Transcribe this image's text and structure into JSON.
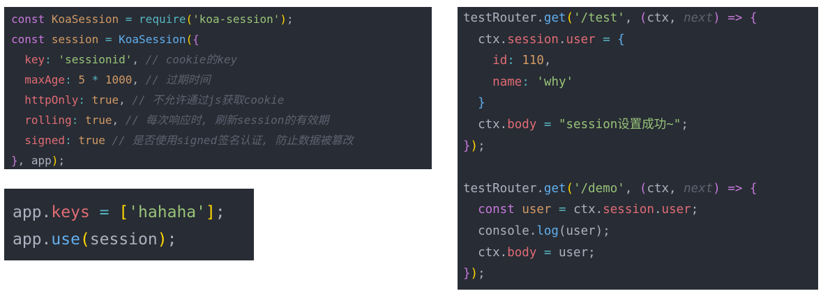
{
  "colors": {
    "background": "#282c34",
    "keyword": "#c678dd",
    "variable": "#d19a66",
    "function": "#56b6c2",
    "string": "#98c379",
    "bracket": "#ffd700",
    "method": "#61afef",
    "property": "#e06c75",
    "comment": "#5c6370",
    "plain": "#abb2bf"
  },
  "snippets": [
    {
      "name": "koa-session-config",
      "lines": [
        [
          [
            "const",
            "k"
          ],
          [
            " ",
            "p"
          ],
          [
            "KoaSession",
            "v"
          ],
          [
            " = ",
            "f"
          ],
          [
            "require",
            "f"
          ],
          [
            "(",
            "y"
          ],
          [
            "'koa-session'",
            "s"
          ],
          [
            ")",
            "y"
          ],
          [
            ";",
            "p"
          ]
        ],
        [
          [
            "const",
            "k"
          ],
          [
            " ",
            "p"
          ],
          [
            "session",
            "v"
          ],
          [
            " = ",
            "f"
          ],
          [
            "KoaSession",
            "b"
          ],
          [
            "(",
            "y"
          ],
          [
            "{",
            "m"
          ]
        ],
        [
          [
            "  ",
            "p"
          ],
          [
            "key",
            "r"
          ],
          [
            ": ",
            "f"
          ],
          [
            "'sessionid'",
            "s"
          ],
          [
            ", ",
            "p"
          ],
          [
            "// cookie的key",
            "c"
          ]
        ],
        [
          [
            "  ",
            "p"
          ],
          [
            "maxAge",
            "r"
          ],
          [
            ": ",
            "f"
          ],
          [
            "5",
            "v"
          ],
          [
            " * ",
            "f"
          ],
          [
            "1000",
            "v"
          ],
          [
            ", ",
            "p"
          ],
          [
            "// 过期时间",
            "c"
          ]
        ],
        [
          [
            "  ",
            "p"
          ],
          [
            "httpOnly",
            "r"
          ],
          [
            ": ",
            "f"
          ],
          [
            "true",
            "v"
          ],
          [
            ", ",
            "p"
          ],
          [
            "// 不允许通过js获取cookie",
            "c"
          ]
        ],
        [
          [
            "  ",
            "p"
          ],
          [
            "rolling",
            "r"
          ],
          [
            ": ",
            "f"
          ],
          [
            "true",
            "v"
          ],
          [
            ", ",
            "p"
          ],
          [
            "// 每次响应时, 刷新session的有效期",
            "c"
          ]
        ],
        [
          [
            "  ",
            "p"
          ],
          [
            "signed",
            "r"
          ],
          [
            ": ",
            "f"
          ],
          [
            "true",
            "v"
          ],
          [
            " ",
            "p"
          ],
          [
            "// 是否使用signed签名认证, 防止数据被篡改",
            "c"
          ]
        ],
        [
          [
            "}",
            "m"
          ],
          [
            ", app",
            "p"
          ],
          [
            ")",
            "y"
          ],
          [
            ";",
            "p"
          ]
        ]
      ]
    },
    {
      "name": "app-keys",
      "lines": [
        [
          [
            "app",
            "p"
          ],
          [
            ".",
            "p"
          ],
          [
            "keys",
            "r"
          ],
          [
            " = ",
            "f"
          ],
          [
            "[",
            "y"
          ],
          [
            "'hahaha'",
            "s"
          ],
          [
            "]",
            "y"
          ],
          [
            ";",
            "p"
          ]
        ],
        [
          [
            "app",
            "p"
          ],
          [
            ".",
            "p"
          ],
          [
            "use",
            "b"
          ],
          [
            "(",
            "y"
          ],
          [
            "session",
            "p"
          ],
          [
            ")",
            "y"
          ],
          [
            ";",
            "p"
          ]
        ]
      ]
    },
    {
      "name": "test-router",
      "lines": [
        [
          [
            "testRouter",
            "p"
          ],
          [
            ".",
            "p"
          ],
          [
            "get",
            "b"
          ],
          [
            "(",
            "y"
          ],
          [
            "'/test'",
            "s"
          ],
          [
            ", ",
            "p"
          ],
          [
            "(",
            "m"
          ],
          [
            "ctx, ",
            "p"
          ],
          [
            "next",
            "c"
          ],
          [
            ")",
            "m"
          ],
          [
            " => ",
            "k"
          ],
          [
            "{",
            "m"
          ]
        ],
        [
          [
            "  ctx.",
            "p"
          ],
          [
            "session",
            "r"
          ],
          [
            ".",
            "p"
          ],
          [
            "user",
            "r"
          ],
          [
            " = ",
            "f"
          ],
          [
            "{",
            "b"
          ]
        ],
        [
          [
            "    ",
            "p"
          ],
          [
            "id",
            "r"
          ],
          [
            ": ",
            "f"
          ],
          [
            "110",
            "v"
          ],
          [
            ",",
            "p"
          ]
        ],
        [
          [
            "    ",
            "p"
          ],
          [
            "name",
            "r"
          ],
          [
            ": ",
            "f"
          ],
          [
            "'why'",
            "s"
          ]
        ],
        [
          [
            "  ",
            "p"
          ],
          [
            "}",
            "b"
          ]
        ],
        [
          [
            "  ctx.",
            "p"
          ],
          [
            "body",
            "r"
          ],
          [
            " = ",
            "f"
          ],
          [
            "\"session设置成功~\"",
            "s"
          ],
          [
            ";",
            "p"
          ]
        ],
        [
          [
            "}",
            "m"
          ],
          [
            ")",
            "y"
          ],
          [
            ";",
            "p"
          ]
        ],
        [
          [
            " ",
            "p"
          ]
        ],
        [
          [
            "testRouter",
            "p"
          ],
          [
            ".",
            "p"
          ],
          [
            "get",
            "b"
          ],
          [
            "(",
            "y"
          ],
          [
            "'/demo'",
            "s"
          ],
          [
            ", ",
            "p"
          ],
          [
            "(",
            "m"
          ],
          [
            "ctx, ",
            "p"
          ],
          [
            "next",
            "c"
          ],
          [
            ")",
            "m"
          ],
          [
            " => ",
            "k"
          ],
          [
            "{",
            "m"
          ]
        ],
        [
          [
            "  ",
            "p"
          ],
          [
            "const",
            "k"
          ],
          [
            " ",
            "p"
          ],
          [
            "user",
            "v"
          ],
          [
            " = ",
            "f"
          ],
          [
            "ctx.",
            "p"
          ],
          [
            "session",
            "r"
          ],
          [
            ".",
            "p"
          ],
          [
            "user",
            "r"
          ],
          [
            ";",
            "p"
          ]
        ],
        [
          [
            "  console.",
            "p"
          ],
          [
            "log",
            "b"
          ],
          [
            "(user)",
            "p"
          ],
          [
            ";",
            "p"
          ]
        ],
        [
          [
            "  ctx.",
            "p"
          ],
          [
            "body",
            "r"
          ],
          [
            " = ",
            "f"
          ],
          [
            "user;",
            "p"
          ]
        ],
        [
          [
            "}",
            "m"
          ],
          [
            ")",
            "y"
          ],
          [
            ";",
            "p"
          ]
        ]
      ]
    }
  ]
}
